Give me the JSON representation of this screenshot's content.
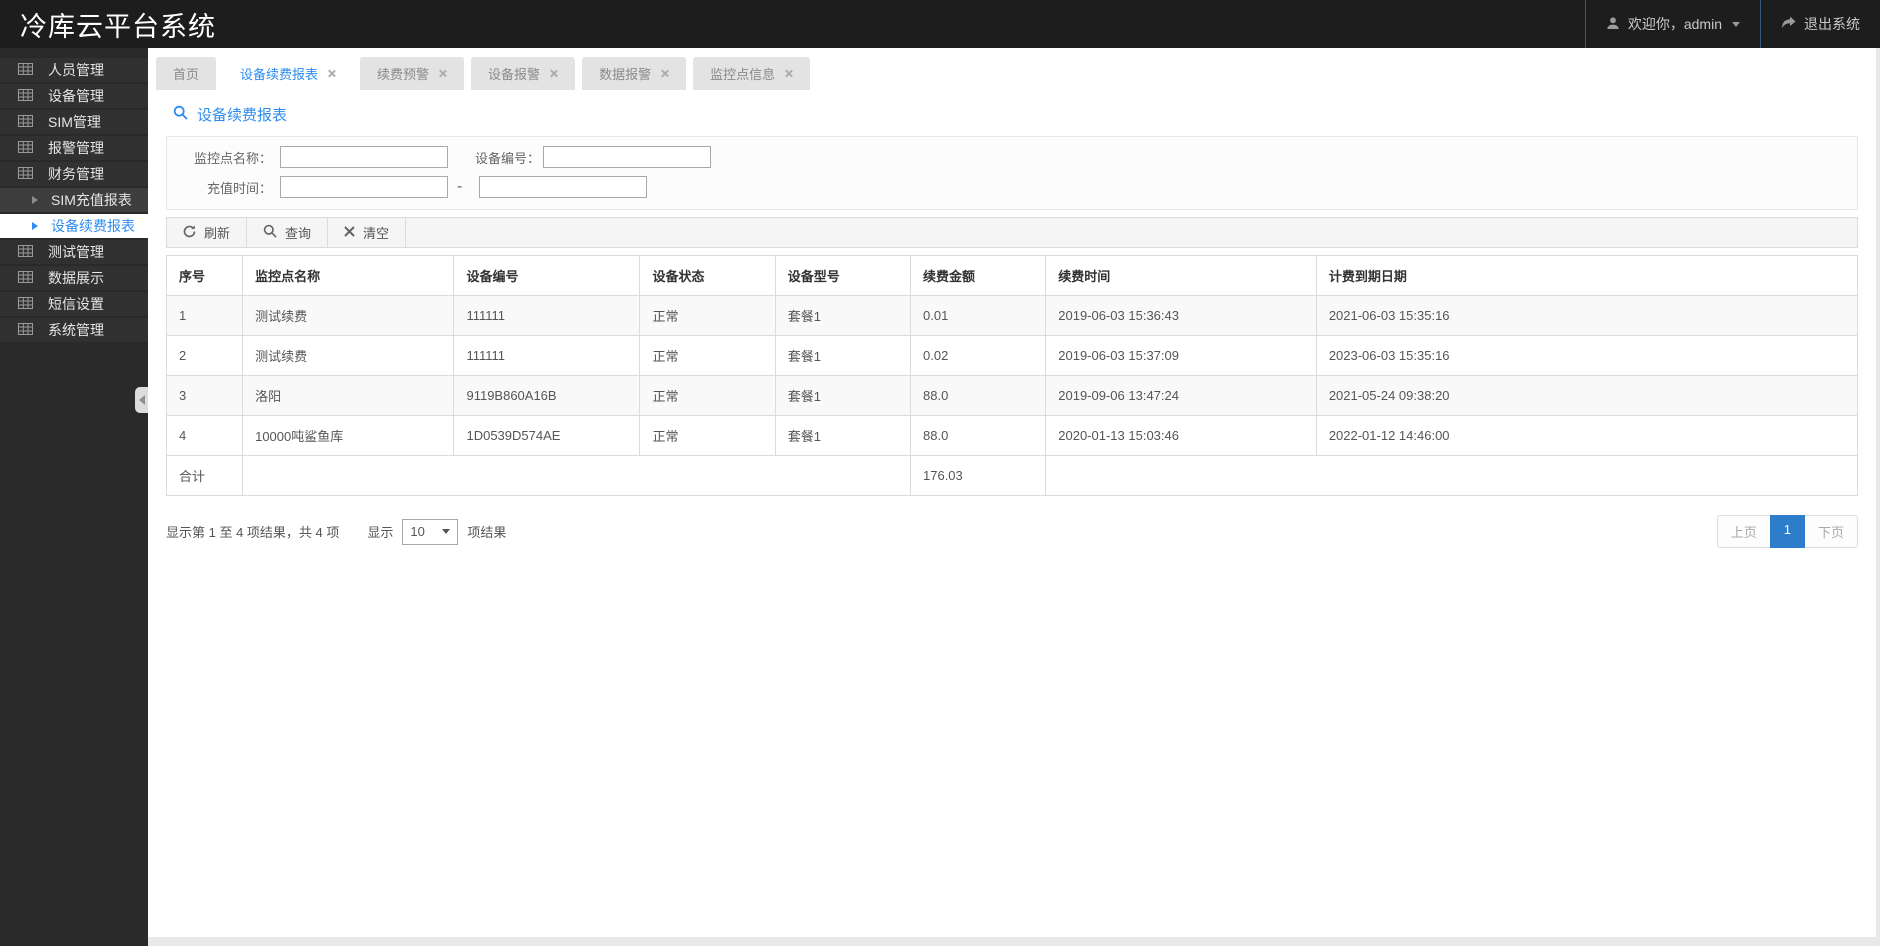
{
  "app": {
    "title": "冷库云平台系统"
  },
  "header": {
    "welcome": "欢迎你，admin",
    "logout": "退出系统"
  },
  "sidebar": {
    "items": [
      {
        "label": "人员管理"
      },
      {
        "label": "设备管理"
      },
      {
        "label": "SIM管理"
      },
      {
        "label": "报警管理"
      },
      {
        "label": "财务管理"
      },
      {
        "label": "SIM充值报表"
      },
      {
        "label": "设备续费报表"
      },
      {
        "label": "测试管理"
      },
      {
        "label": "数据展示"
      },
      {
        "label": "短信设置"
      },
      {
        "label": "系统管理"
      }
    ]
  },
  "tabs": [
    {
      "label": "首页"
    },
    {
      "label": "设备续费报表"
    },
    {
      "label": "续费预警"
    },
    {
      "label": "设备报警"
    },
    {
      "label": "数据报警"
    },
    {
      "label": "监控点信息"
    }
  ],
  "page": {
    "title": "设备续费报表"
  },
  "form": {
    "monitor_label": "监控点名称：",
    "device_label": "设备编号：",
    "time_label": "充值时间：",
    "monitor_value": "",
    "device_value": "",
    "time_from": "",
    "time_to": "",
    "range_separator": "-"
  },
  "toolbar": {
    "refresh": "刷新",
    "search": "查询",
    "clear": "清空"
  },
  "table": {
    "columns": [
      "序号",
      "监控点名称",
      "设备编号",
      "设备状态",
      "设备型号",
      "续费金额",
      "续费时间",
      "计费到期日期"
    ],
    "rows": [
      [
        "1",
        "测试续费",
        "111111",
        "正常",
        "套餐1",
        "0.01",
        "2019-06-03 15:36:43",
        "2021-06-03 15:35:16"
      ],
      [
        "2",
        "测试续费",
        "111111",
        "正常",
        "套餐1",
        "0.02",
        "2019-06-03 15:37:09",
        "2023-06-03 15:35:16"
      ],
      [
        "3",
        "洛阳",
        "9119B860A16B",
        "正常",
        "套餐1",
        "88.0",
        "2019-09-06 13:47:24",
        "2021-05-24 09:38:20"
      ],
      [
        "4",
        "10000吨鲨鱼库",
        "1D0539D574AE",
        "正常",
        "套餐1",
        "88.0",
        "2020-01-13 15:03:46",
        "2022-01-12 14:46:00"
      ]
    ],
    "total_label": "合计",
    "total_amount": "176.03"
  },
  "pagination": {
    "summary": "显示第 1 至 4 项结果，共 4 项",
    "show_label": "显示",
    "page_size": "10",
    "unit_label": "项结果",
    "prev": "上页",
    "current": "1",
    "next": "下页"
  },
  "colors": {
    "accent": "#2d8cf0",
    "active_page_bg": "#2d7dcb",
    "header_bg": "#1d1d1d",
    "sidebar_bg": "#2a2a2a"
  }
}
